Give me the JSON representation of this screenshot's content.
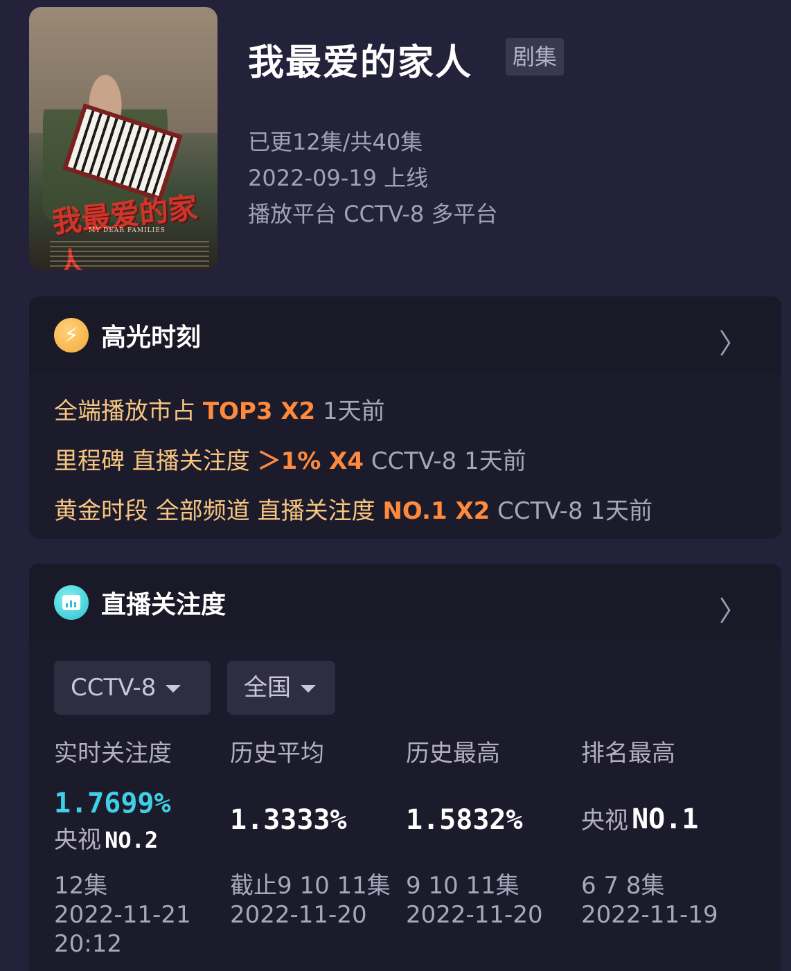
{
  "show": {
    "title": "我最爱的家人",
    "type_tag": "剧集",
    "episodes": "已更12集/共40集",
    "release": "2022-09-19 上线",
    "platform": "播放平台 CCTV-8 多平台",
    "poster_title": "我最爱的家人",
    "poster_subtitle": "MY DEAR FAMILIES"
  },
  "highlights": {
    "title": "高光时刻",
    "items": [
      {
        "label": "全端播放市占",
        "value": "TOP3 X2",
        "extra": "1天前"
      },
      {
        "label": "里程碑 直播关注度",
        "value": "＞1% X4",
        "extra": "CCTV-8 1天前"
      },
      {
        "label": "黄金时段 全部频道 直播关注度",
        "value": "NO.1 X2",
        "extra": "CCTV-8 1天前"
      }
    ]
  },
  "live": {
    "title": "直播关注度",
    "channel": "CCTV-8",
    "region": "全国",
    "columns": [
      {
        "label": "实时关注度",
        "value": "1.7699%",
        "rank_prefix": "央视",
        "rank": "NO.2",
        "foot1": "12集",
        "foot2": "2022-11-21",
        "foot3": "20:12"
      },
      {
        "label": "历史平均",
        "value": "1.3333%",
        "foot1": "截止9 10 11集",
        "foot2": "2022-11-20"
      },
      {
        "label": "历史最高",
        "value": "1.5832%",
        "foot1": "9 10 11集",
        "foot2": "2022-11-20"
      },
      {
        "label": "排名最高",
        "rank_prefix": "央视",
        "rank": "NO.1",
        "foot1": "6 7 8集",
        "foot2": "2022-11-19"
      }
    ]
  },
  "colors": {
    "background": "#24223a",
    "accent_orange": "#ff8a3d",
    "accent_gold": "#f7c580",
    "accent_cyan": "#3fd0e6"
  },
  "icons": [
    "lightning-bolt-icon",
    "chart-bubble-icon",
    "chevron-right-icon",
    "caret-down-icon"
  ]
}
